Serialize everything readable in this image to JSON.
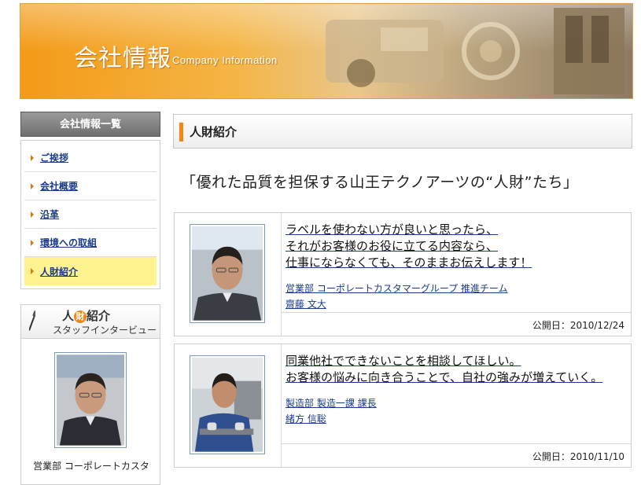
{
  "header": {
    "title_ja": "会社情報",
    "title_en": "Company Information"
  },
  "sidebar": {
    "heading": "会社情報一覧",
    "items": [
      {
        "label": "ご挨拶"
      },
      {
        "label": "会社概要"
      },
      {
        "label": "沿革"
      },
      {
        "label": "環境への取組"
      },
      {
        "label": "人財紹介",
        "active": true
      }
    ],
    "staff": {
      "title_pre": "人",
      "title_hl": "財",
      "title_post": "紹介",
      "subtitle": "スタッフインタービュー",
      "caption": "営業部 コーポレートカスタ"
    }
  },
  "main": {
    "section_title": "人財紹介",
    "headline": "「優れた品質を担保する山王テクノアーツの“人財”たち」",
    "cards": [
      {
        "quote_lines": [
          "ラベルを使わない方が良いと思ったら、",
          "それがお客様のお役に立てる内容なら、",
          "仕事にならなくても、そのままお伝えします！"
        ],
        "dept": "営業部 コーポレートカスタマーグループ 推進チーム",
        "name": "齋藤 文大",
        "date": "公開日：2010/12/24"
      },
      {
        "quote_lines": [
          "同業他社でできないことを相談してほしい。",
          "お客様の悩みに向き合うことで、自社の強みが増えていく。"
        ],
        "dept": "製造部 製造一課 課長",
        "name": "緒方 信聡",
        "date": "公開日：2010/11/10"
      }
    ]
  },
  "colors": {
    "accent": "#f08a12",
    "link": "#1b3c8a",
    "active_bg": "#fff38f"
  }
}
